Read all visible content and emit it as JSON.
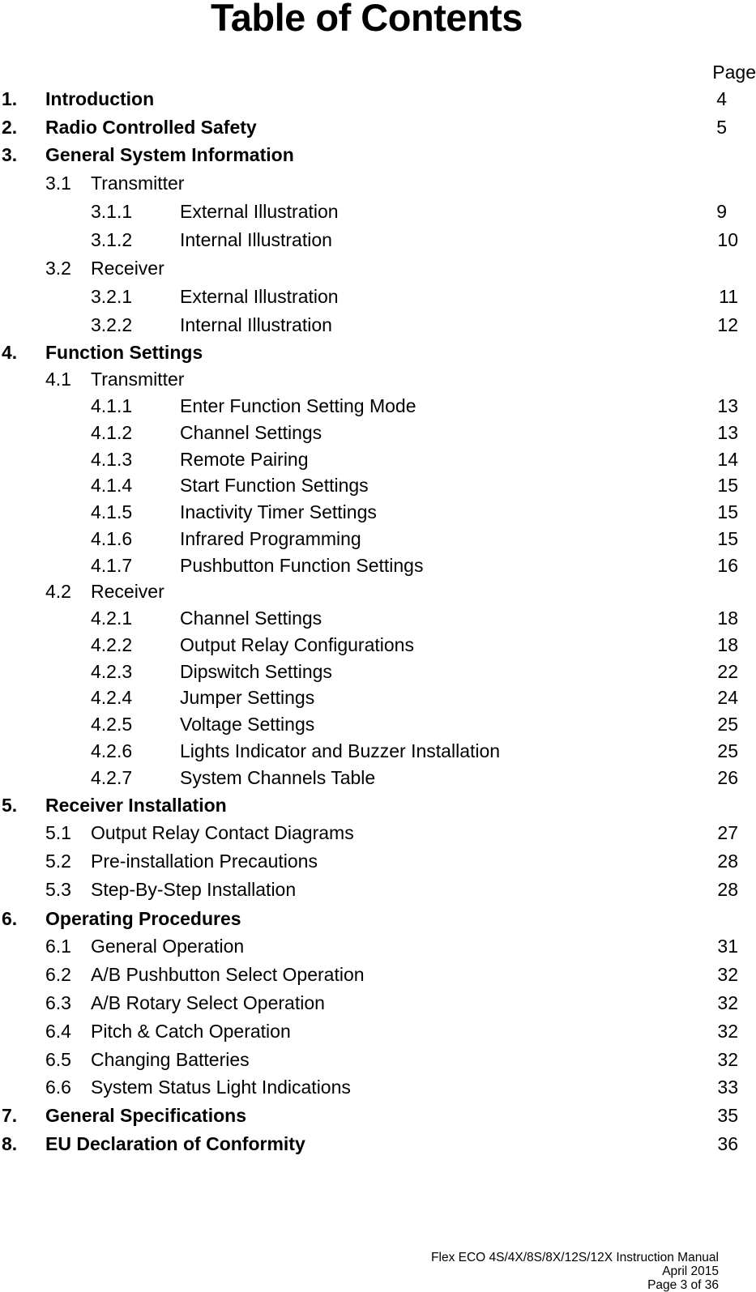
{
  "title": "Table of Contents",
  "page_header": "Page",
  "entries": [
    {
      "level": 1,
      "num": "1.",
      "label": "Introduction",
      "page": "4"
    },
    {
      "level": 1,
      "num": "2.",
      "label": "Radio Controlled Safety",
      "page": "5"
    },
    {
      "level": 1,
      "num": "3.",
      "label": "General System Information",
      "page": ""
    },
    {
      "level": 2,
      "num": "3.1",
      "label": "Transmitter",
      "page": ""
    },
    {
      "level": 3,
      "num": "3.1.1",
      "label": "External Illustration",
      "page": "9"
    },
    {
      "level": 3,
      "num": "3.1.2",
      "label": "Internal Illustration",
      "page": "10"
    },
    {
      "level": 2,
      "num": "3.2",
      "label": "Receiver",
      "page": ""
    },
    {
      "level": 3,
      "num": "3.2.1",
      "label": "External Illustration",
      "page": "11"
    },
    {
      "level": 3,
      "num": "3.2.2",
      "label": "Internal Illustration",
      "page": "12"
    },
    {
      "level": 1,
      "num": "4.",
      "label": "Function Settings",
      "page": ""
    },
    {
      "level": 2,
      "num": "4.1",
      "label": "Transmitter",
      "page": ""
    },
    {
      "level": 3,
      "num": "4.1.1",
      "label": "Enter Function Setting Mode",
      "page": "13"
    },
    {
      "level": 3,
      "num": "4.1.2",
      "label": "Channel Settings",
      "page": "13"
    },
    {
      "level": 3,
      "num": "4.1.3",
      "label": "Remote Pairing",
      "page": "14"
    },
    {
      "level": 3,
      "num": "4.1.4",
      "label": "Start Function Settings",
      "page": "15"
    },
    {
      "level": 3,
      "num": "4.1.5",
      "label": "Inactivity Timer Settings",
      "page": "15"
    },
    {
      "level": 3,
      "num": "4.1.6",
      "label": "Infrared Programming",
      "page": "15"
    },
    {
      "level": 3,
      "num": "4.1.7",
      "label": "Pushbutton Function Settings",
      "page": "16"
    },
    {
      "level": 2,
      "num": "4.2",
      "label": "Receiver",
      "page": ""
    },
    {
      "level": 3,
      "num": "4.2.1",
      "label": "Channel Settings",
      "page": "18"
    },
    {
      "level": 3,
      "num": "4.2.2",
      "label": "Output Relay Configurations",
      "page": "18"
    },
    {
      "level": 3,
      "num": "4.2.3",
      "label": "Dipswitch Settings",
      "page": "22"
    },
    {
      "level": 3,
      "num": "4.2.4",
      "label": "Jumper Settings",
      "page": "24"
    },
    {
      "level": 3,
      "num": "4.2.5",
      "label": "Voltage Settings",
      "page": "25"
    },
    {
      "level": 3,
      "num": "4.2.6",
      "label": "Lights Indicator and Buzzer Installation",
      "page": "25"
    },
    {
      "level": 3,
      "num": "4.2.7",
      "label": "System Channels Table",
      "page": "26"
    },
    {
      "level": 1,
      "num": "5.",
      "label": "Receiver Installation",
      "page": ""
    },
    {
      "level": 2,
      "num": "5.1",
      "label": "Output Relay Contact Diagrams",
      "page": "27"
    },
    {
      "level": 2,
      "num": "5.2",
      "label": "Pre-installation Precautions",
      "page": "28"
    },
    {
      "level": 2,
      "num": "5.3",
      "label": "Step-By-Step Installation",
      "page": "28"
    },
    {
      "level": 1,
      "num": "6.",
      "label": "Operating Procedures",
      "page": ""
    },
    {
      "level": 2,
      "num": "6.1",
      "label": "General Operation",
      "page": "31"
    },
    {
      "level": 2,
      "num": "6.2",
      "label": "A/B Pushbutton Select Operation",
      "page": "32"
    },
    {
      "level": 2,
      "num": "6.3",
      "label": "A/B Rotary Select Operation",
      "page": "32"
    },
    {
      "level": 2,
      "num": "6.4",
      "label": "Pitch & Catch Operation",
      "page": "32"
    },
    {
      "level": 2,
      "num": "6.5",
      "label": "Changing Batteries",
      "page": "32"
    },
    {
      "level": 2,
      "num": "6.6",
      "label": "System Status Light Indications",
      "page": "33"
    },
    {
      "level": 1,
      "num": "7.",
      "label": "General Specifications",
      "page": "35"
    },
    {
      "level": 1,
      "num": "8.",
      "label": "EU Declaration of Conformity",
      "page": "36"
    }
  ],
  "footer": {
    "manual": "Flex ECO 4S/4X/8S/8X/12S/12X Instruction Manual",
    "date": "April 2015",
    "page": "Page 3 of 36"
  }
}
